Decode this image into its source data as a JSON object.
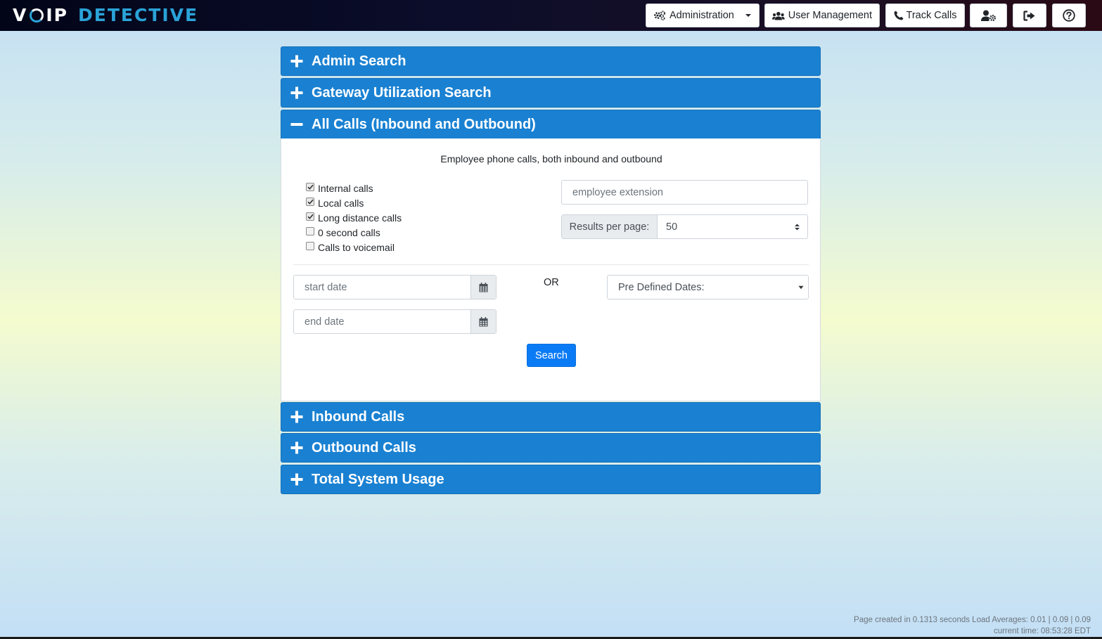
{
  "app": {
    "logo_part1": "V",
    "logo_part2": "IP",
    "logo_part3": "DETECTIVE"
  },
  "nav": {
    "administration": {
      "label": "Administration",
      "icon": "cogs-icon"
    },
    "user_management": {
      "label": "User Management",
      "icon": "users-icon"
    },
    "track_calls": {
      "label": "Track Calls",
      "icon": "phone-icon"
    },
    "user_settings_icon": "user-cog-icon",
    "logout_icon": "sign-out-icon",
    "help_icon": "help-circle-icon"
  },
  "panels": [
    {
      "title": "Admin Search",
      "expanded": false
    },
    {
      "title": "Gateway Utilization Search",
      "expanded": false
    },
    {
      "title": "All Calls (Inbound and Outbound)",
      "expanded": true
    },
    {
      "title": "Inbound Calls",
      "expanded": false
    },
    {
      "title": "Outbound Calls",
      "expanded": false
    },
    {
      "title": "Total System Usage",
      "expanded": false
    }
  ],
  "all_calls": {
    "description": "Employee phone calls, both inbound and outbound",
    "checkboxes": [
      {
        "label": "Internal calls",
        "checked": true
      },
      {
        "label": "Local calls",
        "checked": true
      },
      {
        "label": "Long distance calls",
        "checked": true
      },
      {
        "label": "0 second calls",
        "checked": false
      },
      {
        "label": "Calls to voicemail",
        "checked": false
      }
    ],
    "extension_placeholder": "employee extension",
    "results_per_page_label": "Results per page:",
    "results_per_page_value": "50",
    "start_date_placeholder": "start date",
    "end_date_placeholder": "end date",
    "or_label": "OR",
    "predefined_dates_value": "Pre Defined Dates:",
    "search_label": "Search"
  },
  "footer": {
    "line1": "Page created in 0.1313 seconds Load Averages: 0.01 | 0.09 | 0.09",
    "line2": "current time: 08:53:28 EDT"
  },
  "colors": {
    "panel_header": "#1a81d2",
    "primary_button": "#0b7bf5",
    "logo_accent": "#2aa3d8"
  }
}
